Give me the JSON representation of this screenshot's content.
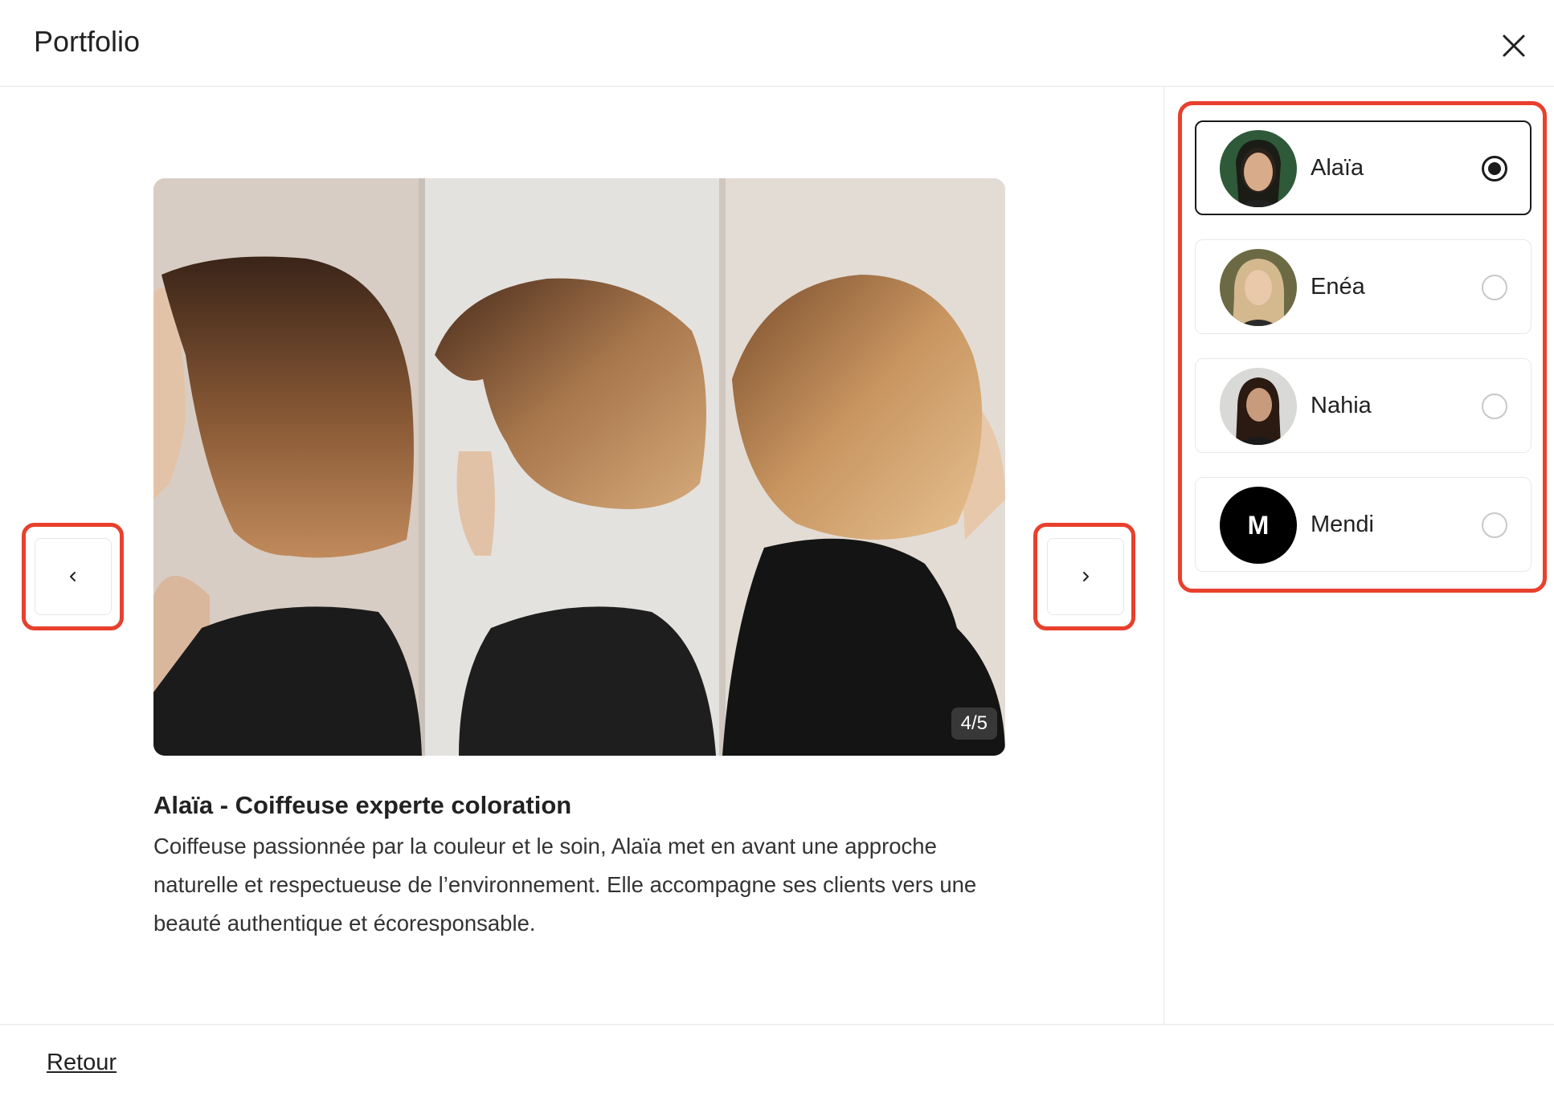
{
  "header": {
    "title": "Portfolio",
    "close_icon": "close-icon"
  },
  "gallery": {
    "counter": "4/5",
    "prev_icon": "chevron-left-icon",
    "next_icon": "chevron-right-icon",
    "caption_title": "Alaïa - Coiffeuse experte coloration",
    "caption_text": "Coiffeuse passionnée par la couleur et le soin, Alaïa met en avant une approche naturelle et respectueuse de l’environnement. Elle accompagne ses clients vers une beauté authentique et écoresponsable."
  },
  "stylists": [
    {
      "name": "Alaïa",
      "selected": true
    },
    {
      "name": "Enéa",
      "selected": false
    },
    {
      "name": "Nahia",
      "selected": false
    },
    {
      "name": "Mendi",
      "selected": false,
      "initial": "M"
    }
  ],
  "footer": {
    "back_label": "Retour"
  },
  "colors": {
    "highlight": "#e8402d",
    "text": "#222222",
    "divider": "#e7e7e7"
  }
}
